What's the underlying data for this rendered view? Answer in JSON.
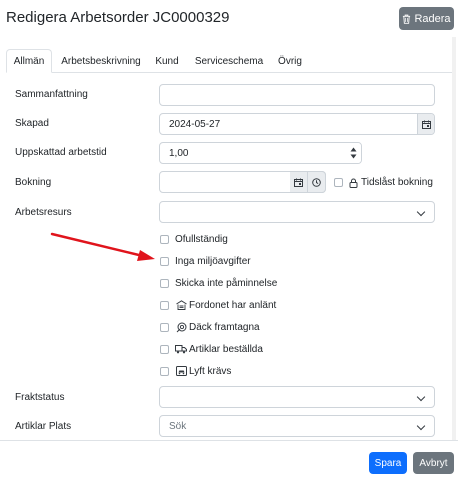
{
  "dialog": {
    "title": "Redigera Arbetsorder JC0000329",
    "delete_label": "Radera"
  },
  "tabs": [
    {
      "label": "Allmän"
    },
    {
      "label": "Arbetsbeskrivning"
    },
    {
      "label": "Kund"
    },
    {
      "label": "Serviceschema"
    },
    {
      "label": "Övrig"
    }
  ],
  "form": {
    "summary_label": "Sammanfattning",
    "summary_value": "",
    "created_label": "Skapad",
    "created_value": "2024-05-27",
    "estimated_label": "Uppskattad arbetstid",
    "estimated_value": "1,00",
    "booking_label": "Bokning",
    "booking_value": "",
    "timelocked_label": "Tidslåst bokning",
    "resource_label": "Arbetsresurs",
    "resource_value": "",
    "checkboxes": [
      {
        "label": "Ofullständig",
        "checked": false
      },
      {
        "label": "Inga miljöavgifter",
        "checked": false
      },
      {
        "label": "Skicka inte påminnelse",
        "checked": false
      },
      {
        "label": "Fordonet har anlänt",
        "checked": false,
        "icon": "garage-icon"
      },
      {
        "label": "Däck framtagna",
        "checked": false,
        "icon": "tire-icon"
      },
      {
        "label": "Artiklar beställda",
        "checked": false,
        "icon": "truck-icon"
      },
      {
        "label": "Lyft krävs",
        "checked": false,
        "icon": "lift-icon"
      }
    ],
    "freight_label": "Fraktstatus",
    "freight_value": "",
    "article_location_label": "Artiklar Plats",
    "article_location_placeholder": "Sök"
  },
  "footer": {
    "save_label": "Spara",
    "cancel_label": "Avbryt"
  },
  "colors": {
    "primary": "#0d6efd",
    "secondary": "#6c757d",
    "arrow": "#e0141c"
  }
}
